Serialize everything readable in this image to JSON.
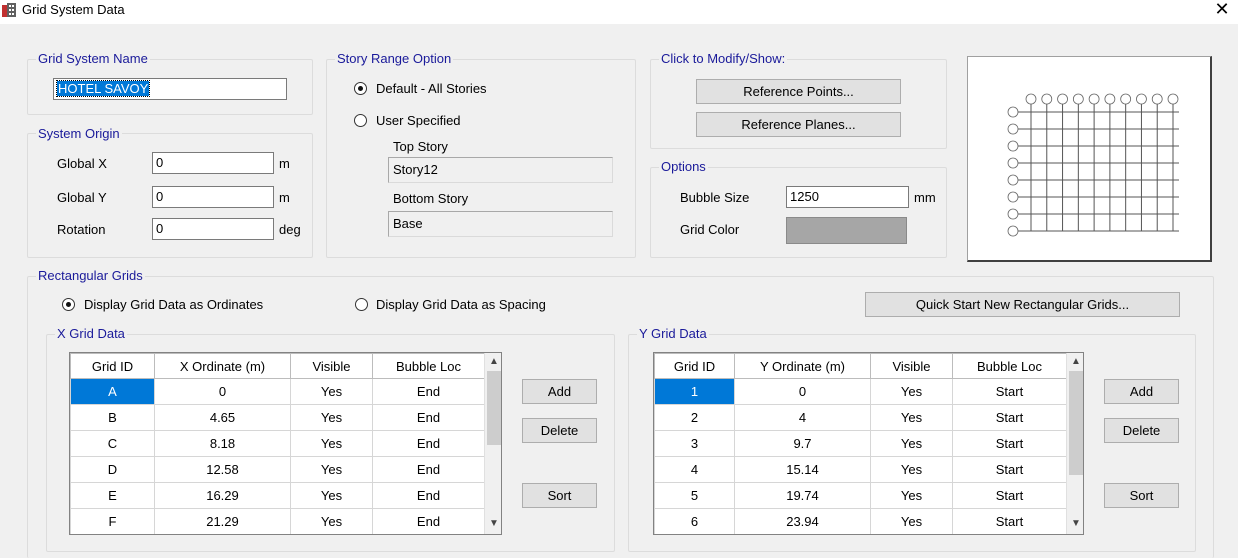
{
  "window": {
    "title": "Grid System Data",
    "close_glyph": "✕"
  },
  "grid_system_name": {
    "legend": "Grid System Name",
    "value": "HOTEL SAVOY"
  },
  "system_origin": {
    "legend": "System Origin",
    "global_x": {
      "label": "Global  X",
      "value": "0",
      "unit": "m"
    },
    "global_y": {
      "label": "Global  Y",
      "value": "0",
      "unit": "m"
    },
    "rotation": {
      "label": "Rotation",
      "value": "0",
      "unit": "deg"
    }
  },
  "story_range": {
    "legend": "Story Range Option",
    "default_label": "Default - All Stories",
    "user_label": "User Specified",
    "top_story_label": "Top Story",
    "top_story_value": "Story12",
    "bottom_story_label": "Bottom Story",
    "bottom_story_value": "Base",
    "selected": "default"
  },
  "modify_show": {
    "legend": "Click to Modify/Show:",
    "reference_points": "Reference Points...",
    "reference_planes": "Reference Planes..."
  },
  "options": {
    "legend": "Options",
    "bubble_size_label": "Bubble Size",
    "bubble_size_value": "1250",
    "bubble_size_unit": "mm",
    "grid_color_label": "Grid Color",
    "grid_color": "#a6a6a6"
  },
  "preview": {
    "x_bubble_count": 10,
    "y_bubble_count": 8
  },
  "rectangular_grids": {
    "legend": "Rectangular Grids",
    "display_ordinates": "Display Grid Data as Ordinates",
    "display_spacing": "Display Grid Data as Spacing",
    "selected": "ordinates",
    "quick_start": "Quick Start New Rectangular Grids..."
  },
  "x_grid": {
    "legend": "X Grid Data",
    "headers": [
      "Grid ID",
      "X Ordinate (m)",
      "Visible",
      "Bubble Loc"
    ],
    "rows": [
      [
        "A",
        "0",
        "Yes",
        "End"
      ],
      [
        "B",
        "4.65",
        "Yes",
        "End"
      ],
      [
        "C",
        "8.18",
        "Yes",
        "End"
      ],
      [
        "D",
        "12.58",
        "Yes",
        "End"
      ],
      [
        "E",
        "16.29",
        "Yes",
        "End"
      ],
      [
        "F",
        "21.29",
        "Yes",
        "End"
      ]
    ],
    "add": "Add",
    "delete": "Delete",
    "sort": "Sort"
  },
  "y_grid": {
    "legend": "Y Grid Data",
    "headers": [
      "Grid ID",
      "Y Ordinate (m)",
      "Visible",
      "Bubble Loc"
    ],
    "rows": [
      [
        "1",
        "0",
        "Yes",
        "Start"
      ],
      [
        "2",
        "4",
        "Yes",
        "Start"
      ],
      [
        "3",
        "9.7",
        "Yes",
        "Start"
      ],
      [
        "4",
        "15.14",
        "Yes",
        "Start"
      ],
      [
        "5",
        "19.74",
        "Yes",
        "Start"
      ],
      [
        "6",
        "23.94",
        "Yes",
        "Start"
      ]
    ],
    "add": "Add",
    "delete": "Delete",
    "sort": "Sort"
  },
  "colors": {
    "selection": "#0078d7",
    "legend_text": "#1a1a9a"
  }
}
